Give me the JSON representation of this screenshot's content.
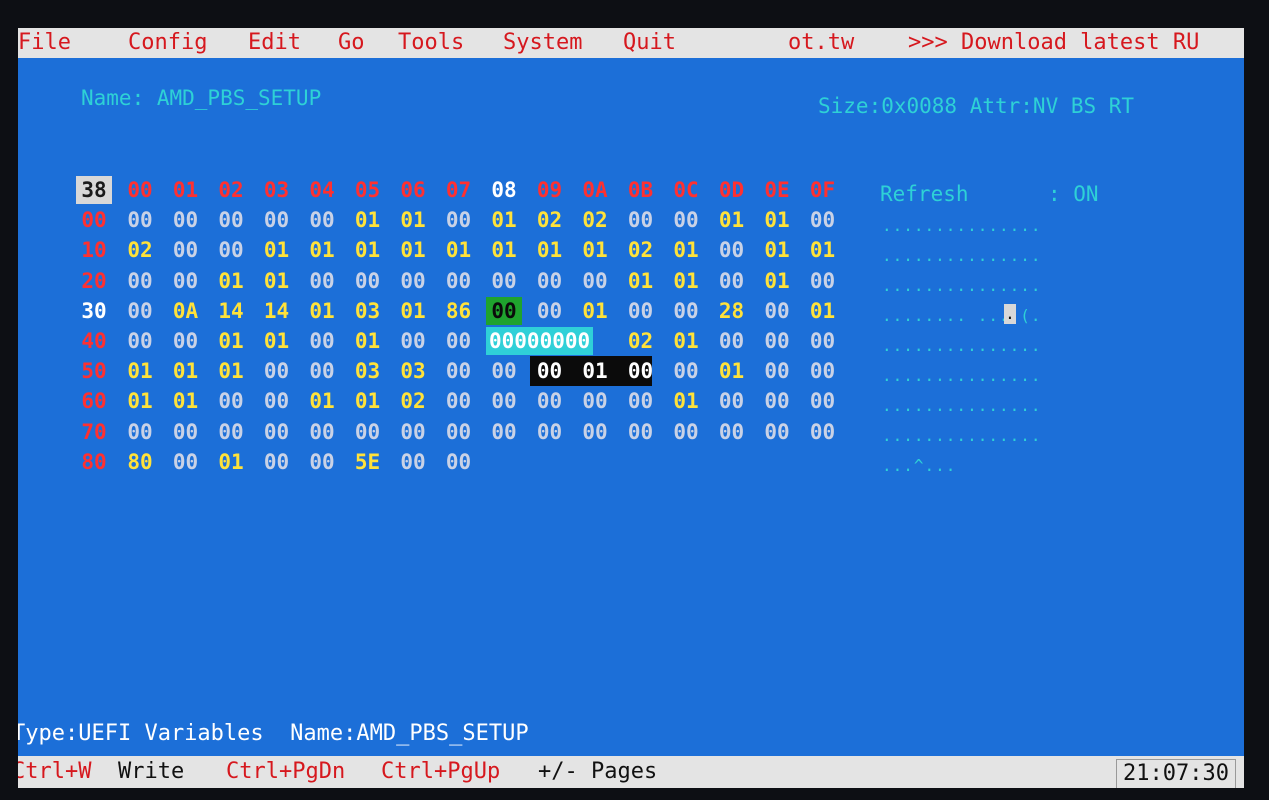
{
  "menu": {
    "items": [
      {
        "hot": "F",
        "rest": "ile"
      },
      {
        "hot": "C",
        "rest": "onfig"
      },
      {
        "hot": "E",
        "rest": "dit"
      },
      {
        "hot": "G",
        "rest": "o"
      },
      {
        "hot": "T",
        "rest": "ools"
      },
      {
        "hot": "S",
        "rest": "ystem"
      },
      {
        "hot": "Q",
        "rest": "uit"
      }
    ],
    "site": "ot.tw",
    "banner": ">>> Download latest RU"
  },
  "header": {
    "name": "Name: AMD_PBS_SETUP",
    "size_attr": "Size:0x0088 Attr:NV BS RT"
  },
  "hex": {
    "corner": "38",
    "columns": [
      "00",
      "01",
      "02",
      "03",
      "04",
      "05",
      "06",
      "07",
      "08",
      "09",
      "0A",
      "0B",
      "0C",
      "0D",
      "0E",
      "0F"
    ],
    "rows": [
      {
        "addr": "00",
        "bytes": [
          "00",
          "00",
          "00",
          "00",
          "00",
          "01",
          "01",
          "00",
          "01",
          "02",
          "02",
          "00",
          "00",
          "01",
          "01",
          "00"
        ]
      },
      {
        "addr": "10",
        "bytes": [
          "02",
          "00",
          "00",
          "01",
          "01",
          "01",
          "01",
          "01",
          "01",
          "01",
          "01",
          "02",
          "01",
          "00",
          "01",
          "01"
        ]
      },
      {
        "addr": "20",
        "bytes": [
          "00",
          "00",
          "01",
          "01",
          "00",
          "00",
          "00",
          "00",
          "00",
          "00",
          "00",
          "01",
          "01",
          "00",
          "01",
          "00"
        ]
      },
      {
        "addr": "30",
        "bytes": [
          "00",
          "0A",
          "14",
          "14",
          "01",
          "03",
          "01",
          "86",
          "00",
          "00",
          "01",
          "00",
          "00",
          "28",
          "00",
          "01"
        ]
      },
      {
        "addr": "40",
        "bytes": [
          "00",
          "00",
          "01",
          "01",
          "00",
          "01",
          "00",
          "00",
          "",
          "",
          "",
          "02",
          "01",
          "00",
          "00",
          "00"
        ]
      },
      {
        "addr": "50",
        "bytes": [
          "01",
          "01",
          "01",
          "00",
          "00",
          "03",
          "03",
          "00",
          "00",
          "00",
          "01",
          "00",
          "00",
          "01",
          "00",
          "00"
        ]
      },
      {
        "addr": "60",
        "bytes": [
          "01",
          "01",
          "00",
          "00",
          "01",
          "01",
          "02",
          "00",
          "00",
          "00",
          "00",
          "00",
          "01",
          "00",
          "00",
          "00"
        ]
      },
      {
        "addr": "70",
        "bytes": [
          "00",
          "00",
          "00",
          "00",
          "00",
          "00",
          "00",
          "00",
          "00",
          "00",
          "00",
          "00",
          "00",
          "00",
          "00",
          "00"
        ]
      },
      {
        "addr": "80",
        "bytes": [
          "80",
          "00",
          "01",
          "00",
          "00",
          "5E",
          "00",
          "00"
        ]
      }
    ],
    "edit_value": "00000000"
  },
  "side": {
    "refresh_label": "Refresh",
    "refresh_value": ": ON",
    "ascii_rows": [
      "...............",
      "...............",
      "...............",
      "........ ....(.",
      "...............",
      "...............",
      "...............",
      "...............",
      "...^..."
    ],
    "cursor_char": "."
  },
  "footer": {
    "type_label": "Type:UEFI Variables",
    "name_label": "Name:AMD_PBS_SETUP",
    "keys": [
      {
        "key": "Ctrl+W",
        "desc": "Write"
      },
      {
        "key": "Ctrl+PgDn",
        "desc": ""
      },
      {
        "key": "Ctrl+PgUp",
        "desc": ""
      },
      {
        "key": "",
        "desc": "+/- Pages"
      }
    ],
    "clock": "21:07:30"
  },
  "colors": {
    "screen_bg": "#1c6fd8",
    "bar_bg": "#e4e4e4",
    "hotkey": "#d6181e",
    "cyan": "#2ed1d6",
    "yellow": "#ffe23a",
    "red": "#ff3030"
  }
}
